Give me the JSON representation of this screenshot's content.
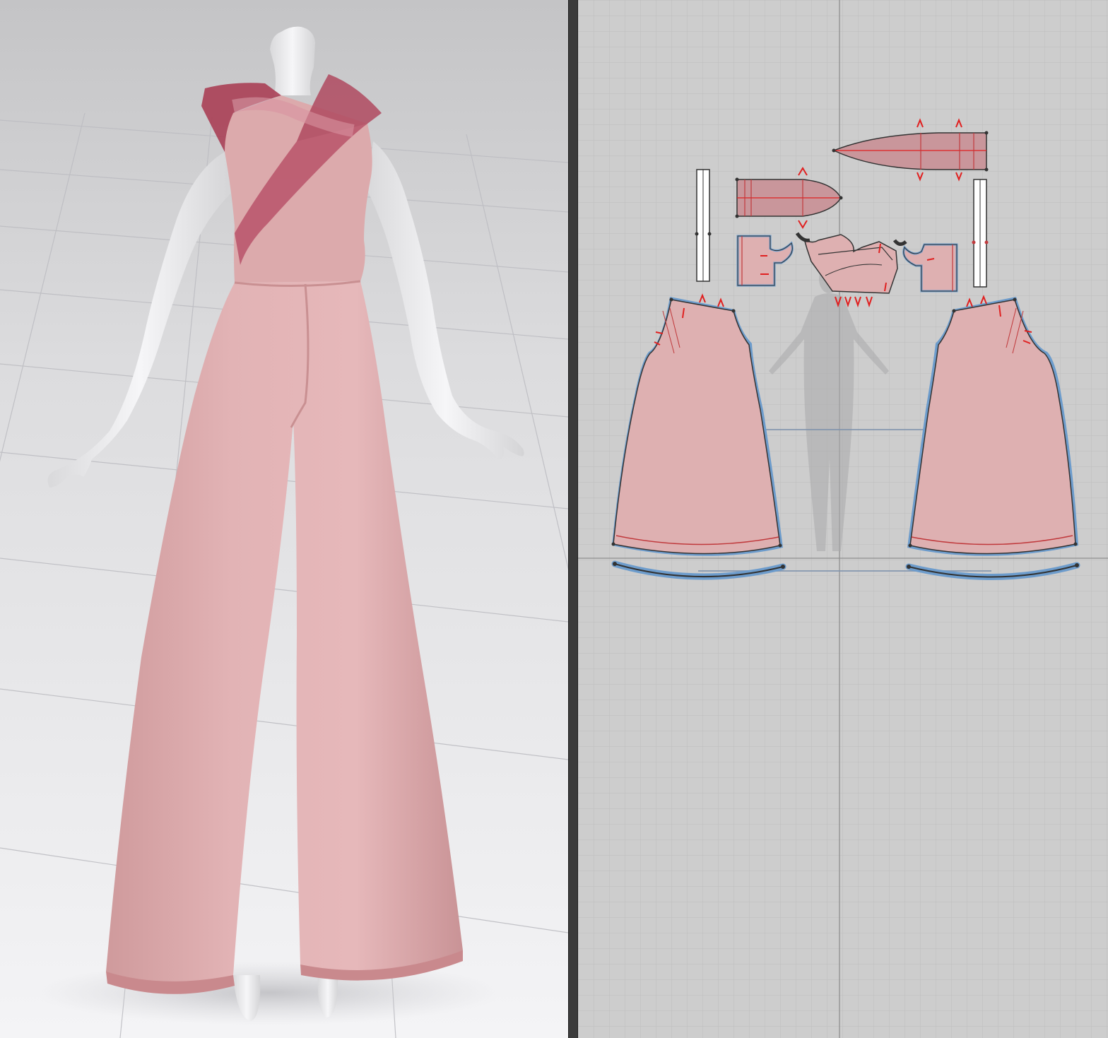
{
  "app": {
    "views": [
      "3d-avatar-window",
      "2d-pattern-window"
    ]
  },
  "viewport3d": {
    "background_top": "#c9c9cb",
    "floor_color": "#f1f1f3",
    "mannequin_color": "#ececee",
    "garment_color": "#dfaeb0",
    "accent_color": "#a8384f"
  },
  "viewport2d": {
    "background_color": "#cdcdcd",
    "grid_color": "#bcbcbc",
    "piece_fill": "#deb0b1",
    "outline_color": "#6d9ccc",
    "notch_color": "#e02020",
    "seam_color": "#c0393c",
    "dark_piece_fill": "#c9969b"
  },
  "pattern_pieces": [
    "strap-left",
    "strap-right",
    "sash-long",
    "sash-short",
    "cuff-left",
    "cuff-right",
    "bodice-front",
    "trouser-left",
    "trouser-right",
    "hem-band-left",
    "hem-band-right"
  ]
}
